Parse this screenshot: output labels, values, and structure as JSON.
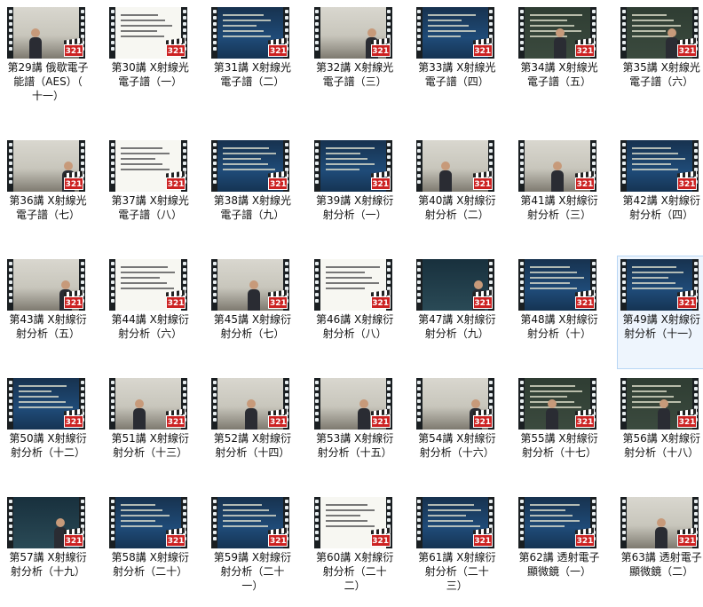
{
  "badge_label": "321",
  "items": [
    {
      "title": "第29講 俄歇電子\n能譜（AES）（\n十一）",
      "style": "classroom"
    },
    {
      "title": "第30講 X射線光\n電子譜（一）",
      "style": "white"
    },
    {
      "title": "第31講 X射線光\n電子譜（二）",
      "style": "slide"
    },
    {
      "title": "第32講 X射線光\n電子譜（三）",
      "style": "classroom"
    },
    {
      "title": "第33講 X射線光\n電子譜（四）",
      "style": "slide"
    },
    {
      "title": "第34講 X射線光\n電子譜（五）",
      "style": "board"
    },
    {
      "title": "第35講 X射線光\n電子譜（六）",
      "style": "board"
    },
    {
      "title": "第36講 X射線光\n電子譜（七）",
      "style": "classroom"
    },
    {
      "title": "第37講 X射線光\n電子譜（八）",
      "style": "white"
    },
    {
      "title": "第38講 X射線光\n電子譜（九）",
      "style": "slide"
    },
    {
      "title": "第39講 X射線衍\n射分析（一）",
      "style": "slide"
    },
    {
      "title": "第40講 X射線衍\n射分析（二）",
      "style": "classroom"
    },
    {
      "title": "第41講 X射線衍\n射分析（三）",
      "style": "classroom"
    },
    {
      "title": "第42講 X射線衍\n射分析（四）",
      "style": "slide"
    },
    {
      "title": "第43講 X射線衍\n射分析（五）",
      "style": "classroom"
    },
    {
      "title": "第44講 X射線衍\n射分析（六）",
      "style": "white"
    },
    {
      "title": "第45講 X射線衍\n射分析（七）",
      "style": "classroom"
    },
    {
      "title": "第46講 X射線衍\n射分析（八）",
      "style": "white"
    },
    {
      "title": "第47講 X射線衍\n射分析（九）",
      "style": "dark"
    },
    {
      "title": "第48講 X射線衍\n射分析（十）",
      "style": "slide"
    },
    {
      "title": "第49講 X射線衍\n射分析（十一）",
      "style": "slide"
    },
    {
      "title": "第50講 X射線衍\n射分析（十二）",
      "style": "slide"
    },
    {
      "title": "第51講 X射線衍\n射分析（十三）",
      "style": "classroom"
    },
    {
      "title": "第52講 X射線衍\n射分析（十四）",
      "style": "classroom"
    },
    {
      "title": "第53講 X射線衍\n射分析（十五）",
      "style": "classroom"
    },
    {
      "title": "第54講 X射線衍\n射分析（十六）",
      "style": "classroom"
    },
    {
      "title": "第55講 X射線衍\n射分析（十七）",
      "style": "board"
    },
    {
      "title": "第56講 X射線衍\n射分析（十八）",
      "style": "board"
    },
    {
      "title": "第57講 X射線衍\n射分析（十九）",
      "style": "dark"
    },
    {
      "title": "第58講 X射線衍\n射分析（二十）",
      "style": "slide"
    },
    {
      "title": "第59講 X射線衍\n射分析（二十\n一）",
      "style": "slide"
    },
    {
      "title": "第60講 X射線衍\n射分析（二十\n二）",
      "style": "white"
    },
    {
      "title": "第61講 X射線衍\n射分析（二十\n三）",
      "style": "slide"
    },
    {
      "title": "第62講 透射電子\n顯微鏡（一）",
      "style": "slide"
    },
    {
      "title": "第63講 透射電子\n顯微鏡（二）",
      "style": "classroom"
    }
  ],
  "selected_index": 20
}
